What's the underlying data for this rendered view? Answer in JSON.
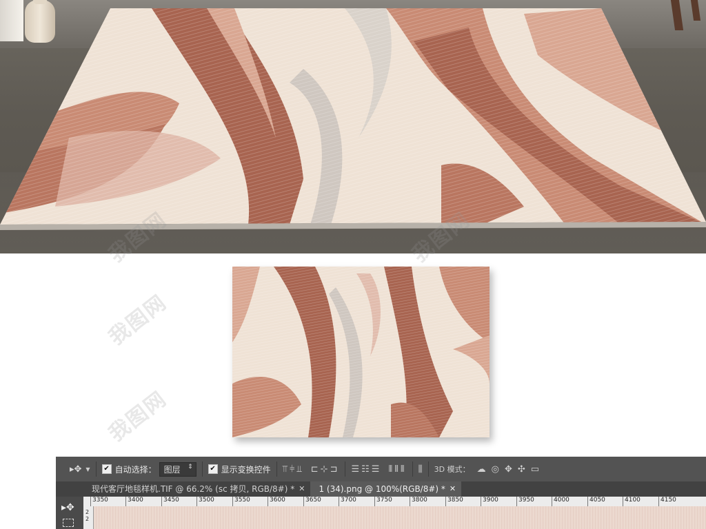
{
  "watermark": {
    "text": "我图网"
  },
  "toolbar": {
    "auto_select_label": "自动选择：",
    "auto_select_checked": true,
    "layer_select_value": "图层",
    "show_transform_label": "显示变换控件",
    "show_transform_checked": true,
    "mode_3d_label": "3D 模式："
  },
  "tabs": [
    {
      "label": "现代客厅地毯样机.TIF @ 66.2% (sc 拷贝, RGB/8#) *",
      "active": false
    },
    {
      "label": "1 (34).png @ 100%(RGB/8#) *",
      "active": true
    }
  ],
  "ruler": {
    "ticks": [
      "3350",
      "3400",
      "3450",
      "3500",
      "3550",
      "3600",
      "3650",
      "3700",
      "3750",
      "3800",
      "3850",
      "3900",
      "3950",
      "4000",
      "4050",
      "4100",
      "4150"
    ],
    "vertical": [
      "2",
      "2"
    ]
  },
  "colors": {
    "ps_panel": "#535353",
    "rug_cream": "#efe2d5",
    "rug_terracotta": "#c98b74",
    "rug_rust": "#a86450"
  }
}
